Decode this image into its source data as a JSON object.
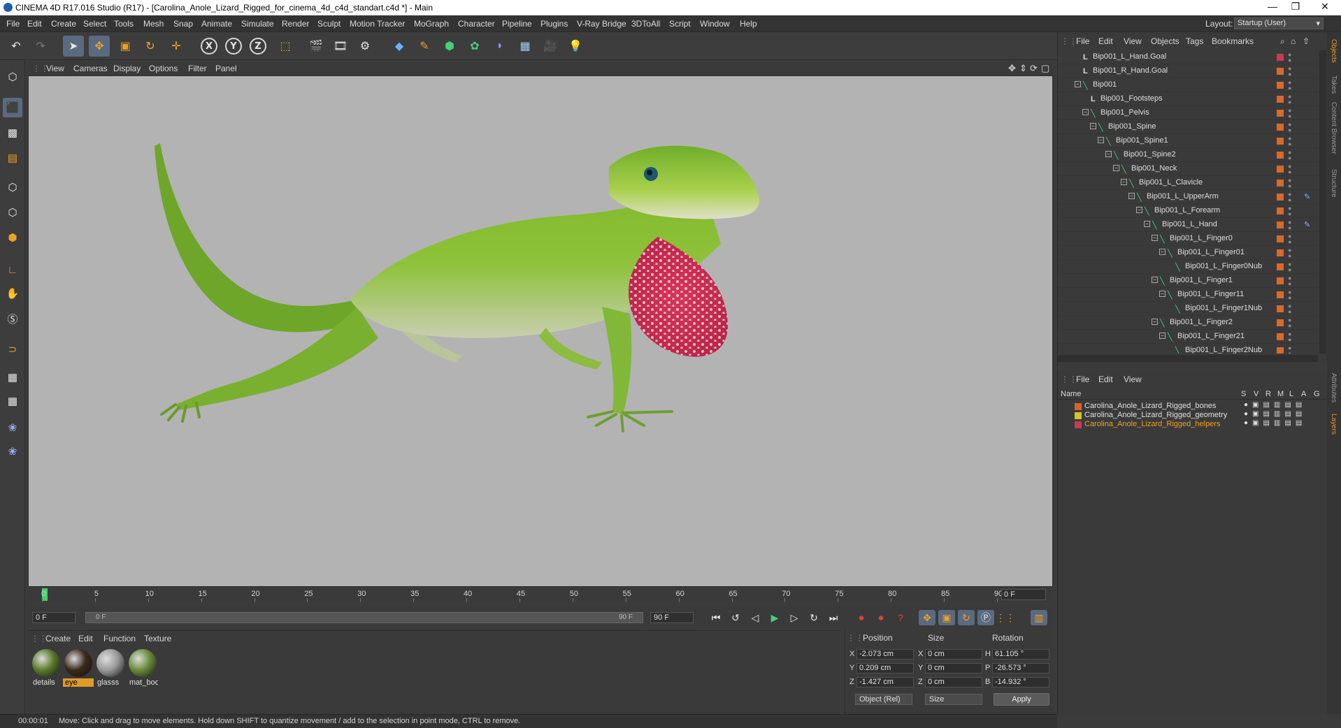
{
  "window": {
    "title": "CINEMA 4D R17.016 Studio (R17) - [Carolina_Anole_Lizard_Rigged_for_cinema_4d_c4d_standart.c4d *] - Main",
    "controls": [
      "—",
      "❐",
      "✕"
    ]
  },
  "menubar": {
    "items": [
      "File",
      "Edit",
      "Create",
      "Select",
      "Tools",
      "Mesh",
      "Snap",
      "Animate",
      "Simulate",
      "Render",
      "Sculpt",
      "Motion Tracker",
      "MoGraph",
      "Character",
      "Pipeline",
      "Plugins",
      "V-Ray Bridge",
      "3DToAll",
      "Script",
      "Window",
      "Help"
    ],
    "layout_label": "Layout:",
    "layout_value": "Startup (User)"
  },
  "toolbar": {
    "axis_labels": [
      "X",
      "Y",
      "Z"
    ]
  },
  "viewport": {
    "menu": [
      "View",
      "Cameras",
      "Display",
      "Options",
      "Filter",
      "Panel"
    ],
    "background": "#b3b3b3"
  },
  "timeline": {
    "ticks": [
      "0",
      "5",
      "10",
      "15",
      "20",
      "25",
      "30",
      "35",
      "40",
      "45",
      "50",
      "55",
      "60",
      "65",
      "70",
      "75",
      "80",
      "85",
      "90"
    ],
    "current_frame_field": "0 F"
  },
  "transport": {
    "start_field": "0 F",
    "slider_start": "0 F",
    "slider_end": "90 F",
    "end_field": "90 F"
  },
  "materials": {
    "menu": [
      "Create",
      "Edit",
      "Function",
      "Texture"
    ],
    "items": [
      {
        "label": "details",
        "color": "#5a7a2a",
        "selected": false
      },
      {
        "label": "eye",
        "color": "#3a2a1a",
        "selected": true
      },
      {
        "label": "glasss",
        "color": "#9a9a9a",
        "selected": false
      },
      {
        "label": "mat_boo",
        "color": "#6a8a3a",
        "selected": false
      }
    ]
  },
  "coordinates": {
    "headers": [
      "Position",
      "Size",
      "Rotation"
    ],
    "rows": [
      {
        "axis": "X",
        "position": "-2.073 cm",
        "size_axis": "X",
        "size": "0 cm",
        "rot_axis": "H",
        "rotation": "61.105 °"
      },
      {
        "axis": "Y",
        "position": "0.209 cm",
        "size_axis": "Y",
        "size": "0 cm",
        "rot_axis": "P",
        "rotation": "-26.573 °"
      },
      {
        "axis": "Z",
        "position": "-1.427 cm",
        "size_axis": "Z",
        "size": "0 cm",
        "rot_axis": "B",
        "rotation": "-14.932 °"
      }
    ],
    "mode_dropdown": "Object (Rel)",
    "size_dropdown": "Size",
    "apply_label": "Apply"
  },
  "status": {
    "time": "00:00:01",
    "message": "Move: Click and drag to move elements. Hold down SHIFT to quantize movement / add to the selection in point mode, CTRL to remove."
  },
  "object_manager": {
    "menu": [
      "File",
      "Edit",
      "View",
      "Objects",
      "Tags",
      "Bookmarks"
    ],
    "rows": [
      {
        "name": "Bip001_L_Hand.Goal",
        "depth": 0,
        "icon": "null",
        "expand": false,
        "ik": false
      },
      {
        "name": "Bip001_R_Hand.Goal",
        "depth": 0,
        "icon": "null",
        "expand": false,
        "ik": false
      },
      {
        "name": "Bip001",
        "depth": 0,
        "icon": "bone",
        "expand": true,
        "ik": false
      },
      {
        "name": "Bip001_Footsteps",
        "depth": 1,
        "icon": "null",
        "expand": false,
        "ik": false
      },
      {
        "name": "Bip001_Pelvis",
        "depth": 1,
        "icon": "bone",
        "expand": true,
        "ik": false
      },
      {
        "name": "Bip001_Spine",
        "depth": 2,
        "icon": "bone",
        "expand": true,
        "ik": false
      },
      {
        "name": "Bip001_Spine1",
        "depth": 3,
        "icon": "bone",
        "expand": true,
        "ik": false
      },
      {
        "name": "Bip001_Spine2",
        "depth": 4,
        "icon": "bone",
        "expand": true,
        "ik": false
      },
      {
        "name": "Bip001_Neck",
        "depth": 5,
        "icon": "bone",
        "expand": true,
        "ik": false
      },
      {
        "name": "Bip001_L_Clavicle",
        "depth": 6,
        "icon": "bone",
        "expand": true,
        "ik": false
      },
      {
        "name": "Bip001_L_UpperArm",
        "depth": 7,
        "icon": "bone",
        "expand": true,
        "ik": true
      },
      {
        "name": "Bip001_L_Forearm",
        "depth": 8,
        "icon": "bone",
        "expand": true,
        "ik": false
      },
      {
        "name": "Bip001_L_Hand",
        "depth": 9,
        "icon": "bone",
        "expand": true,
        "ik": true
      },
      {
        "name": "Bip001_L_Finger0",
        "depth": 10,
        "icon": "bone",
        "expand": true,
        "ik": false
      },
      {
        "name": "Bip001_L_Finger01",
        "depth": 11,
        "icon": "bone",
        "expand": true,
        "ik": false
      },
      {
        "name": "Bip001_L_Finger0Nub",
        "depth": 12,
        "icon": "bone",
        "expand": false,
        "ik": false
      },
      {
        "name": "Bip001_L_Finger1",
        "depth": 10,
        "icon": "bone",
        "expand": true,
        "ik": false
      },
      {
        "name": "Bip001_L_Finger11",
        "depth": 11,
        "icon": "bone",
        "expand": true,
        "ik": false
      },
      {
        "name": "Bip001_L_Finger1Nub",
        "depth": 12,
        "icon": "bone",
        "expand": false,
        "ik": false
      },
      {
        "name": "Bip001_L_Finger2",
        "depth": 10,
        "icon": "bone",
        "expand": true,
        "ik": false
      },
      {
        "name": "Bip001_L_Finger21",
        "depth": 11,
        "icon": "bone",
        "expand": true,
        "ik": false
      },
      {
        "name": "Bip001_L_Finger2Nub",
        "depth": 12,
        "icon": "bone",
        "expand": false,
        "ik": false
      }
    ]
  },
  "layer_manager": {
    "menu": [
      "File",
      "Edit",
      "View"
    ],
    "columns": [
      "Name",
      "S",
      "V",
      "R",
      "M",
      "L",
      "A",
      "G"
    ],
    "layers": [
      {
        "name": "Carolina_Anole_Lizard_Rigged_bones",
        "color": "#d9622b",
        "active": false
      },
      {
        "name": "Carolina_Anole_Lizard_Rigged_geometry",
        "color": "#d8c12a",
        "active": false
      },
      {
        "name": "Carolina_Anole_Lizard_Rigged_helpers",
        "color": "#c73a5a",
        "active": true
      }
    ]
  },
  "side_tabs": [
    "Objects",
    "Takes",
    "Content Browser",
    "Structure",
    "Attributes",
    "Layers"
  ]
}
